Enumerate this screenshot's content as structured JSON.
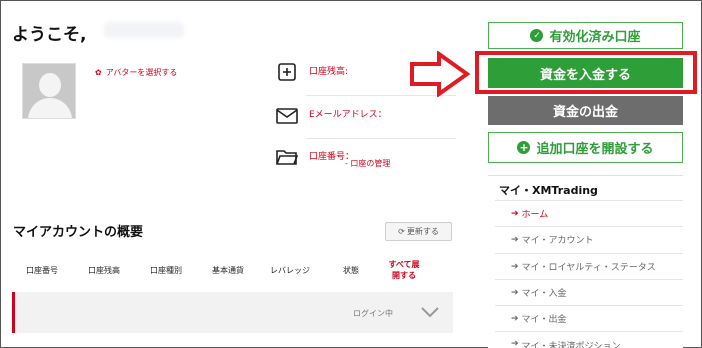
{
  "header": {
    "welcome": "ようこそ,"
  },
  "profile": {
    "avatar_link": "アバターを選択する"
  },
  "info": {
    "balance_label": "口座残高:",
    "email_label": "Eメールアドレス：",
    "account_number_label": "口座番号：",
    "account_manage_link": "- 口座の管理"
  },
  "overview": {
    "title": "マイアカウントの概要",
    "refresh_label": "更新する",
    "columns": [
      "口座番号",
      "口座残高",
      "口座種別",
      "基本通貨",
      "レバレッジ",
      "状態"
    ],
    "expand_all": "すべて展開する",
    "row_status": "ログイン中"
  },
  "actions": {
    "verified": "有効化済み口座",
    "deposit": "資金を入金する",
    "withdraw": "資金の出金",
    "add_account": "追加口座を開設する"
  },
  "menu": {
    "title": "マイ・XMTrading",
    "items": [
      {
        "label": "ホーム",
        "active": true
      },
      {
        "label": "マイ・アカウント",
        "active": false
      },
      {
        "label": "マイ・ロイヤルティ・ステータス",
        "active": false
      },
      {
        "label": "マイ・入金",
        "active": false
      },
      {
        "label": "マイ・出金",
        "active": false
      },
      {
        "label": "マイ・未決済ポジション",
        "active": false
      }
    ]
  },
  "colors": {
    "accent_red": "#d0021b",
    "green": "#2e9e38",
    "gray_button": "#6d6d6d",
    "highlight": "#e01b24"
  }
}
